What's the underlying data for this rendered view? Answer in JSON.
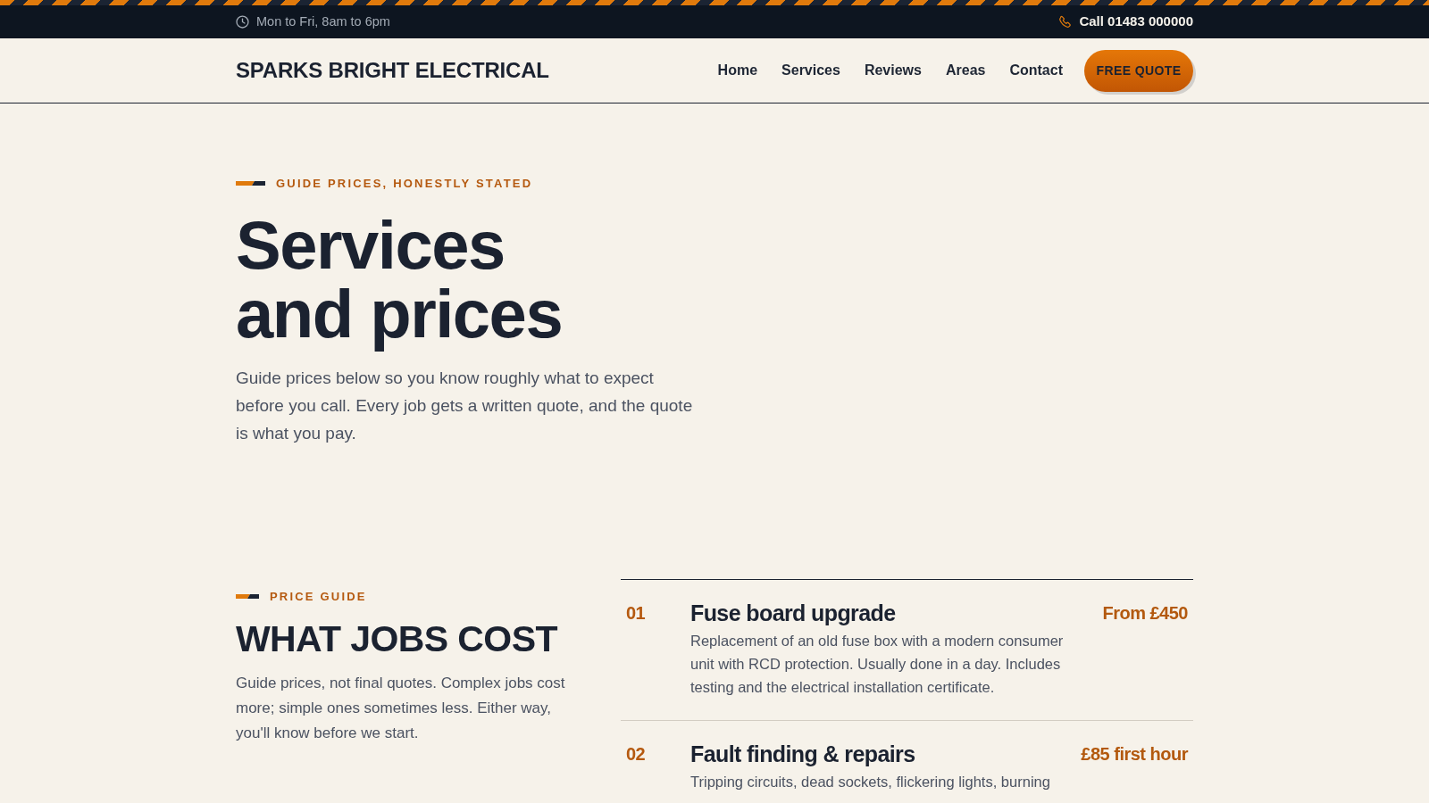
{
  "top_bar": {
    "hours": "Mon to Fri, 8am to 6pm",
    "phone": "Call 01483 000000"
  },
  "navbar": {
    "brand": "SPARKS BRIGHT ELECTRICAL",
    "links": [
      "Home",
      "Services",
      "Reviews",
      "Areas",
      "Contact"
    ],
    "cta": "FREE QUOTE"
  },
  "hero": {
    "eyebrow": "GUIDE PRICES, HONESTLY STATED",
    "heading_lines": [
      "Services",
      "and prices"
    ],
    "intro": "Guide prices below so you know roughly what to expect before you call. Every job gets a written quote, and the quote is what you pay."
  },
  "price_guide": {
    "eyebrow": "PRICE GUIDE",
    "heading": "WHAT JOBS COST",
    "text": "Guide prices, not final quotes. Complex jobs cost more; simple ones sometimes less. Either way, you'll know before we start.",
    "items": [
      {
        "number": "01",
        "title": "Fuse board upgrade",
        "description": "Replacement of an old fuse box with a modern consumer unit with RCD protection. Usually done in a day. Includes testing and the electrical installation certificate.",
        "price": "From £450"
      },
      {
        "number": "02",
        "title": "Fault finding & repairs",
        "description": "Tripping circuits, dead sockets, flickering lights, burning",
        "price": "£85 first hour"
      }
    ]
  }
}
